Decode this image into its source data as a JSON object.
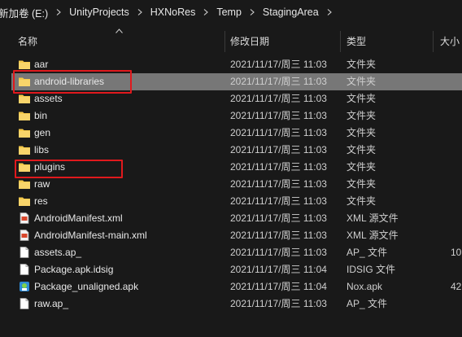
{
  "breadcrumb": [
    "新加卷 (E:)",
    "UnityProjects",
    "HXNoRes",
    "Temp",
    "StagingArea"
  ],
  "columns": {
    "name": "名称",
    "date": "修改日期",
    "type": "类型",
    "size": "大小"
  },
  "files": [
    {
      "name": "aar",
      "date": "2021/11/17/周三 11:03",
      "type": "文件夹",
      "size": "",
      "icon": "folder-icon"
    },
    {
      "name": "android-libraries",
      "date": "2021/11/17/周三 11:03",
      "type": "文件夹",
      "size": "",
      "icon": "folder-icon"
    },
    {
      "name": "assets",
      "date": "2021/11/17/周三 11:03",
      "type": "文件夹",
      "size": "",
      "icon": "folder-icon"
    },
    {
      "name": "bin",
      "date": "2021/11/17/周三 11:03",
      "type": "文件夹",
      "size": "",
      "icon": "folder-icon"
    },
    {
      "name": "gen",
      "date": "2021/11/17/周三 11:03",
      "type": "文件夹",
      "size": "",
      "icon": "folder-icon"
    },
    {
      "name": "libs",
      "date": "2021/11/17/周三 11:03",
      "type": "文件夹",
      "size": "",
      "icon": "folder-icon"
    },
    {
      "name": "plugins",
      "date": "2021/11/17/周三 11:03",
      "type": "文件夹",
      "size": "",
      "icon": "folder-icon"
    },
    {
      "name": "raw",
      "date": "2021/11/17/周三 11:03",
      "type": "文件夹",
      "size": "",
      "icon": "folder-icon"
    },
    {
      "name": "res",
      "date": "2021/11/17/周三 11:03",
      "type": "文件夹",
      "size": "",
      "icon": "folder-icon"
    },
    {
      "name": "AndroidManifest.xml",
      "date": "2021/11/17/周三 11:03",
      "type": "XML 源文件",
      "size": "",
      "icon": "xml-file-icon"
    },
    {
      "name": "AndroidManifest-main.xml",
      "date": "2021/11/17/周三 11:03",
      "type": "XML 源文件",
      "size": "",
      "icon": "xml-file-icon"
    },
    {
      "name": "assets.ap_",
      "date": "2021/11/17/周三 11:03",
      "type": "AP_ 文件",
      "size": "10",
      "icon": "file-icon"
    },
    {
      "name": "Package.apk.idsig",
      "date": "2021/11/17/周三 11:04",
      "type": "IDSIG 文件",
      "size": "",
      "icon": "file-icon"
    },
    {
      "name": "Package_unaligned.apk",
      "date": "2021/11/17/周三 11:04",
      "type": "Nox.apk",
      "size": "42",
      "icon": "apk-icon"
    },
    {
      "name": "raw.ap_",
      "date": "2021/11/17/周三 11:03",
      "type": "AP_ 文件",
      "size": "",
      "icon": "file-icon"
    }
  ],
  "selected_index": 1,
  "highlighted_indices": [
    1,
    6
  ],
  "colors": {
    "background": "#191919",
    "selection": "#777777",
    "folder": "#f5c94a",
    "highlight_box": "#e0191d"
  }
}
